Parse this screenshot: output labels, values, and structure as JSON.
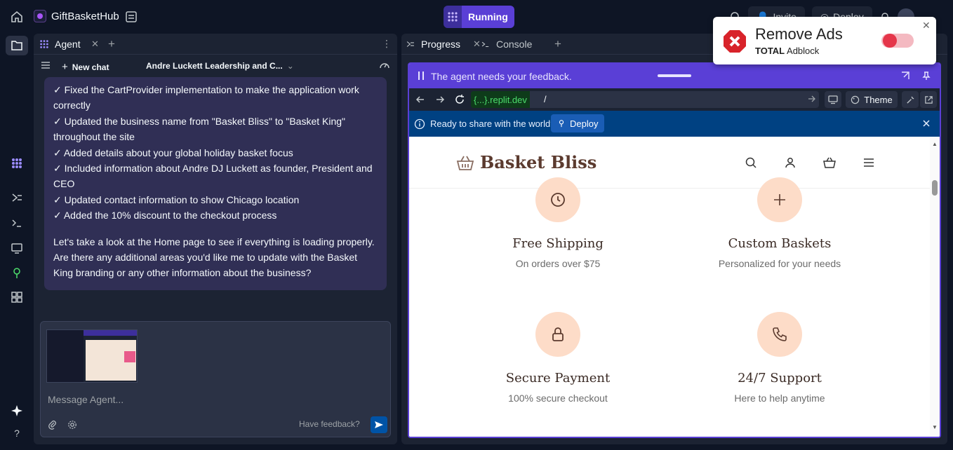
{
  "app": {
    "name": "GiftBasketHub",
    "run_label": "Running"
  },
  "topbar": {
    "invite_label": "Invite",
    "deploy_label": "Deploy"
  },
  "agent": {
    "tab_label": "Agent",
    "new_chat_label": "New chat",
    "chat_title": "Andre Luckett Leadership and C...",
    "message_lines": [
      "✓ Fixed the CartProvider implementation to make the application work correctly",
      "✓ Updated the business name from \"Basket Bliss\" to \"Basket King\" throughout the site",
      "✓ Added details about your global holiday basket focus",
      "✓ Included information about Andre DJ Luckett as founder, President and CEO",
      "✓ Updated contact information to show Chicago location",
      "✓ Added the 10% discount to the checkout process"
    ],
    "message_followup": "Let's take a look at the Home page to see if everything is loading properly. Are there any additional areas you'd like me to update with the Basket King branding or any other information about the business?",
    "composer_placeholder": "Message Agent...",
    "feedback_label": "Have feedback?"
  },
  "right": {
    "tabs": [
      {
        "label": "Progress"
      },
      {
        "label": "Console"
      }
    ],
    "feedback_banner": "The agent needs your feedback.",
    "url_domain": "{...}.replit.dev",
    "url_path": "/",
    "theme_label": "Theme",
    "share_text": "Ready to share with the world?",
    "share_deploy_label": "Deploy"
  },
  "site": {
    "brand": "Basket Bliss",
    "features": [
      {
        "title": "Free Shipping",
        "subtitle": "On orders over $75",
        "icon": "clock-icon"
      },
      {
        "title": "Custom Baskets",
        "subtitle": "Personalized for your needs",
        "icon": "plus-icon"
      },
      {
        "title": "Secure Payment",
        "subtitle": "100% secure checkout",
        "icon": "lock-icon"
      },
      {
        "title": "24/7 Support",
        "subtitle": "Here to help anytime",
        "icon": "phone-icon"
      }
    ]
  },
  "adblock": {
    "title": "Remove Ads",
    "brand_bold": "TOTAL",
    "brand_rest": " Adblock"
  },
  "colors": {
    "accent": "#5a3fd6",
    "bg": "#0e1525",
    "panel": "#1c2333",
    "peach": "#fddcc8",
    "brand_brown": "#5b3a2e"
  }
}
